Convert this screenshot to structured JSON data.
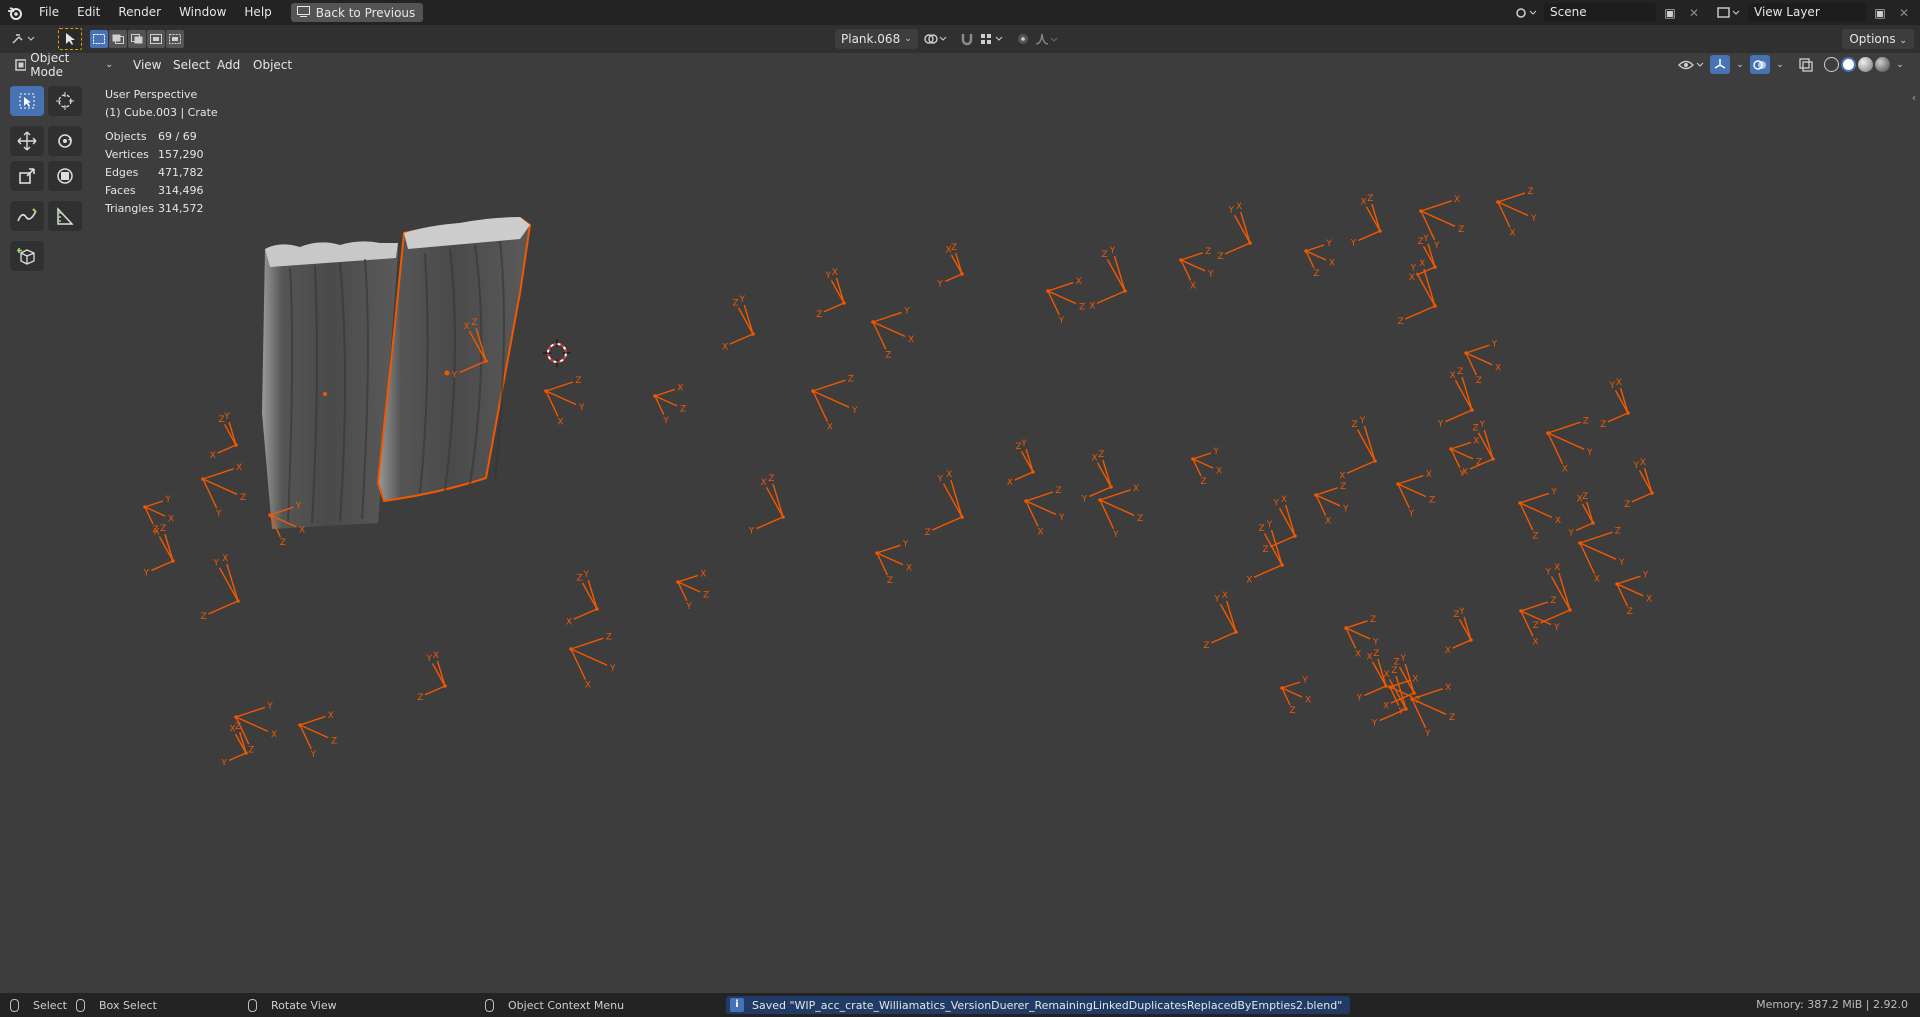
{
  "topbar": {
    "menus": [
      "File",
      "Edit",
      "Render",
      "Window",
      "Help"
    ],
    "back_label": "Back to Previous",
    "scene_value": "Scene",
    "view_layer_value": "View Layer"
  },
  "header": {
    "active_object": "Plank.068",
    "options_label": "Options"
  },
  "viewport_header": {
    "mode": "Object Mode",
    "menus": [
      "View",
      "Select",
      "Add",
      "Object"
    ]
  },
  "overlay": {
    "perspective": "User Perspective",
    "active": "(1) Cube.003 | Crate",
    "stats": [
      {
        "label": "Objects",
        "value": "69 / 69"
      },
      {
        "label": "Vertices",
        "value": "157,290"
      },
      {
        "label": "Edges",
        "value": "471,782"
      },
      {
        "label": "Faces",
        "value": "314,496"
      },
      {
        "label": "Triangles",
        "value": "314,572"
      }
    ]
  },
  "statusbar": {
    "select": "Select",
    "box_select": "Box Select",
    "rotate_view": "Rotate View",
    "context_menu": "Object Context Menu",
    "saved": "Saved \"WIP_acc_crate_Williamatics_VersionDuerer_RemainingLinkedDuplicatesReplacedByEmpties2.blend\"",
    "memory": "Memory: 387.2 MiB | 2.92.0"
  },
  "colors": {
    "accent": "#4772b3",
    "selection": "#f15800",
    "background": "#3d3d3d"
  },
  "icons": [
    "blender-logo-icon",
    "editor-type-icon",
    "select-box-icon",
    "move-icon",
    "rotate-icon",
    "scale-icon",
    "transform-icon",
    "annotate-icon",
    "measure-icon",
    "add-cube-icon",
    "cursor-icon",
    "eye-icon",
    "gizmo-icon",
    "overlay-icon",
    "xray-icon",
    "snap-icon",
    "proportional-icon"
  ]
}
